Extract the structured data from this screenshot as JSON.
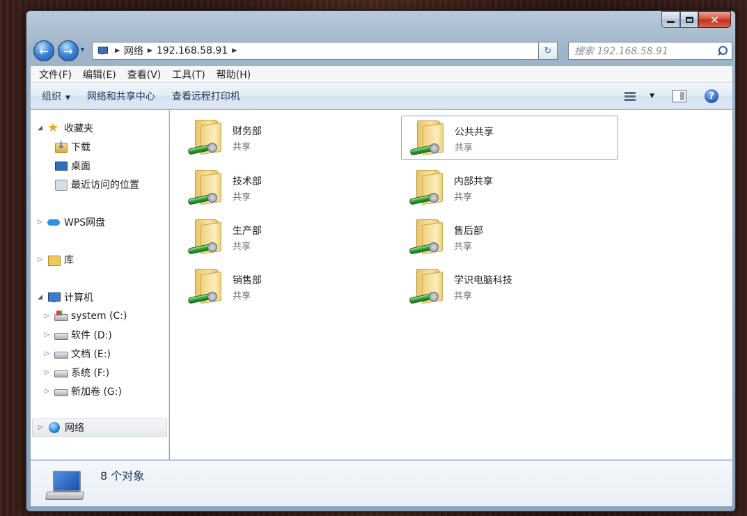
{
  "window": {
    "caption": {
      "minimize": "",
      "maximize": "",
      "close": "✕"
    }
  },
  "navigation": {
    "back_glyph": "←",
    "forward_glyph": "→",
    "history_glyph": "▾",
    "address": {
      "root": "网络",
      "segment": "192.168.58.91"
    },
    "refresh_glyph": "↻",
    "search_placeholder": "搜索 192.168.58.91"
  },
  "menubar": {
    "items": [
      "文件(F)",
      "编辑(E)",
      "查看(V)",
      "工具(T)",
      "帮助(H)"
    ]
  },
  "commandbar": {
    "organize": "组织",
    "network_center": "网络和共享中心",
    "remote_printers": "查看远程打印机",
    "help_glyph": "?"
  },
  "sidebar": {
    "favorites": {
      "label": "收藏夹",
      "items": [
        "下载",
        "桌面",
        "最近访问的位置"
      ]
    },
    "wps": "WPS网盘",
    "library": "库",
    "computer": {
      "label": "计算机",
      "drives": [
        "system (C:)",
        "软件 (D:)",
        "文档 (E:)",
        "系统 (F:)",
        "新加卷 (G:)"
      ]
    },
    "network": "网络"
  },
  "content": {
    "items": [
      {
        "name": "财务部",
        "type": "共享",
        "selected": false
      },
      {
        "name": "公共共享",
        "type": "共享",
        "selected": true
      },
      {
        "name": "技术部",
        "type": "共享",
        "selected": false
      },
      {
        "name": "内部共享",
        "type": "共享",
        "selected": false
      },
      {
        "name": "生产部",
        "type": "共享",
        "selected": false
      },
      {
        "name": "售后部",
        "type": "共享",
        "selected": false
      },
      {
        "name": "销售部",
        "type": "共享",
        "selected": false
      },
      {
        "name": "学识电脑科技",
        "type": "共享",
        "selected": false
      }
    ]
  },
  "details": {
    "count_text": "8 个对象"
  }
}
